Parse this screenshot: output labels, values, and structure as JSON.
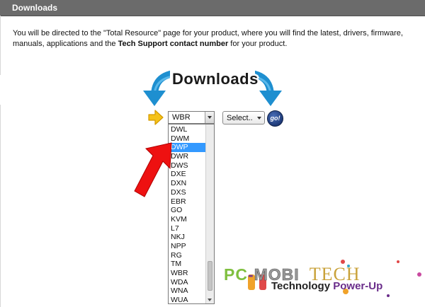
{
  "header": {
    "title": "Downloads"
  },
  "intro": {
    "part1": "You will be directed to the \"Total Resource\" page for your product, where you will find the latest, drivers, firmware, manuals, applications and the ",
    "bold": "Tech Support contact number",
    "part2": " for your product."
  },
  "banner": {
    "title": "Downloads"
  },
  "model_select": {
    "value": "WBR",
    "options": [
      "DWL",
      "DWM",
      "DWP",
      "DWR",
      "DWS",
      "DXE",
      "DXN",
      "DXS",
      "EBR",
      "GO",
      "KVM",
      "L7",
      "NKJ",
      "NPP",
      "RG",
      "TM",
      "WBR",
      "WDA",
      "WNA",
      "WUA"
    ],
    "highlighted": "DWP"
  },
  "product_select": {
    "value": "Select.."
  },
  "go_button": {
    "label": "go!"
  },
  "watermark": {
    "pc": "PC",
    "dash": "-",
    "mobi": "MOBI",
    "tech": "TECH",
    "tagline_main": "Technology ",
    "tagline_accent": "Power-Up"
  },
  "colors": {
    "header_bg": "#6b6b6b",
    "banner_arrows": "#1e8fd0",
    "highlight": "#3399ff",
    "pointer_arrow": "#ee1111",
    "go_button": "#1e3a78"
  },
  "icons": {
    "banner": "curved-download-arrows-icon",
    "pointer": "red-arrow-icon",
    "yellow": "yellow-arrow-icon"
  }
}
